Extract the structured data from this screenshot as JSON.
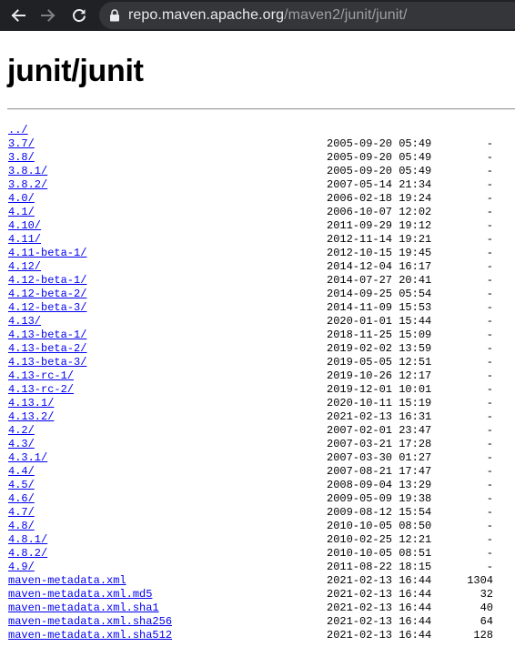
{
  "browser": {
    "url_host": "repo.maven.apache.org",
    "url_path": "/maven2/junit/junit/"
  },
  "page": {
    "title": "junit/junit"
  },
  "entries": [
    {
      "name": "../",
      "date": "",
      "size": ""
    },
    {
      "name": "3.7/",
      "date": "2005-09-20 05:49",
      "size": "-"
    },
    {
      "name": "3.8/",
      "date": "2005-09-20 05:49",
      "size": "-"
    },
    {
      "name": "3.8.1/",
      "date": "2005-09-20 05:49",
      "size": "-"
    },
    {
      "name": "3.8.2/",
      "date": "2007-05-14 21:34",
      "size": "-"
    },
    {
      "name": "4.0/",
      "date": "2006-02-18 19:24",
      "size": "-"
    },
    {
      "name": "4.1/",
      "date": "2006-10-07 12:02",
      "size": "-"
    },
    {
      "name": "4.10/",
      "date": "2011-09-29 19:12",
      "size": "-"
    },
    {
      "name": "4.11/",
      "date": "2012-11-14 19:21",
      "size": "-"
    },
    {
      "name": "4.11-beta-1/",
      "date": "2012-10-15 19:45",
      "size": "-"
    },
    {
      "name": "4.12/",
      "date": "2014-12-04 16:17",
      "size": "-"
    },
    {
      "name": "4.12-beta-1/",
      "date": "2014-07-27 20:41",
      "size": "-"
    },
    {
      "name": "4.12-beta-2/",
      "date": "2014-09-25 05:54",
      "size": "-"
    },
    {
      "name": "4.12-beta-3/",
      "date": "2014-11-09 15:53",
      "size": "-"
    },
    {
      "name": "4.13/",
      "date": "2020-01-01 15:44",
      "size": "-"
    },
    {
      "name": "4.13-beta-1/",
      "date": "2018-11-25 15:09",
      "size": "-"
    },
    {
      "name": "4.13-beta-2/",
      "date": "2019-02-02 13:59",
      "size": "-"
    },
    {
      "name": "4.13-beta-3/",
      "date": "2019-05-05 12:51",
      "size": "-"
    },
    {
      "name": "4.13-rc-1/",
      "date": "2019-10-26 12:17",
      "size": "-"
    },
    {
      "name": "4.13-rc-2/",
      "date": "2019-12-01 10:01",
      "size": "-"
    },
    {
      "name": "4.13.1/",
      "date": "2020-10-11 15:19",
      "size": "-"
    },
    {
      "name": "4.13.2/",
      "date": "2021-02-13 16:31",
      "size": "-"
    },
    {
      "name": "4.2/",
      "date": "2007-02-01 23:47",
      "size": "-"
    },
    {
      "name": "4.3/",
      "date": "2007-03-21 17:28",
      "size": "-"
    },
    {
      "name": "4.3.1/",
      "date": "2007-03-30 01:27",
      "size": "-"
    },
    {
      "name": "4.4/",
      "date": "2007-08-21 17:47",
      "size": "-"
    },
    {
      "name": "4.5/",
      "date": "2008-09-04 13:29",
      "size": "-"
    },
    {
      "name": "4.6/",
      "date": "2009-05-09 19:38",
      "size": "-"
    },
    {
      "name": "4.7/",
      "date": "2009-08-12 15:54",
      "size": "-"
    },
    {
      "name": "4.8/",
      "date": "2010-10-05 08:50",
      "size": "-"
    },
    {
      "name": "4.8.1/",
      "date": "2010-02-25 12:21",
      "size": "-"
    },
    {
      "name": "4.8.2/",
      "date": "2010-10-05 08:51",
      "size": "-"
    },
    {
      "name": "4.9/",
      "date": "2011-08-22 18:15",
      "size": "-"
    },
    {
      "name": "maven-metadata.xml",
      "date": "2021-02-13 16:44",
      "size": "1304"
    },
    {
      "name": "maven-metadata.xml.md5",
      "date": "2021-02-13 16:44",
      "size": "32"
    },
    {
      "name": "maven-metadata.xml.sha1",
      "date": "2021-02-13 16:44",
      "size": "40"
    },
    {
      "name": "maven-metadata.xml.sha256",
      "date": "2021-02-13 16:44",
      "size": "64"
    },
    {
      "name": "maven-metadata.xml.sha512",
      "date": "2021-02-13 16:44",
      "size": "128"
    }
  ],
  "icons": {
    "back": "arrow-left-icon",
    "forward": "arrow-right-icon",
    "reload": "reload-icon",
    "lock": "lock-icon"
  },
  "colors": {
    "toolbar_bg": "#202124",
    "omnibox_bg": "#35363a",
    "link": "#0000ee"
  }
}
